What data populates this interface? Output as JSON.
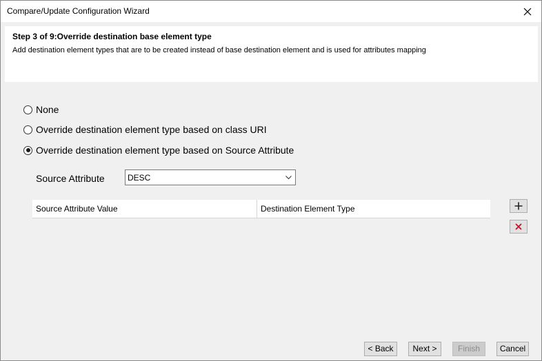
{
  "window": {
    "title": "Compare/Update Configuration Wizard"
  },
  "header": {
    "step_title": "Step 3 of 9:Override destination base element type",
    "step_description": "Add destination element types that are to be created instead of base destination element and is used for attributes mapping"
  },
  "options": [
    {
      "label": "None",
      "checked": false
    },
    {
      "label": "Override destination element type based on class URI",
      "checked": false
    },
    {
      "label": "Override destination element type based on Source Attribute",
      "checked": true
    }
  ],
  "source_attribute": {
    "label": "Source Attribute",
    "value": "DESC"
  },
  "grid": {
    "columns": [
      "Source Attribute Value",
      "Destination Element Type"
    ],
    "rows": []
  },
  "buttons": {
    "back": "< Back",
    "next": "Next >",
    "finish": "Finish",
    "cancel": "Cancel"
  },
  "icons": {
    "close": "close-icon",
    "add": "plus-icon",
    "delete": "delete-x-icon"
  },
  "colors": {
    "delete_icon": "#c8102e"
  }
}
